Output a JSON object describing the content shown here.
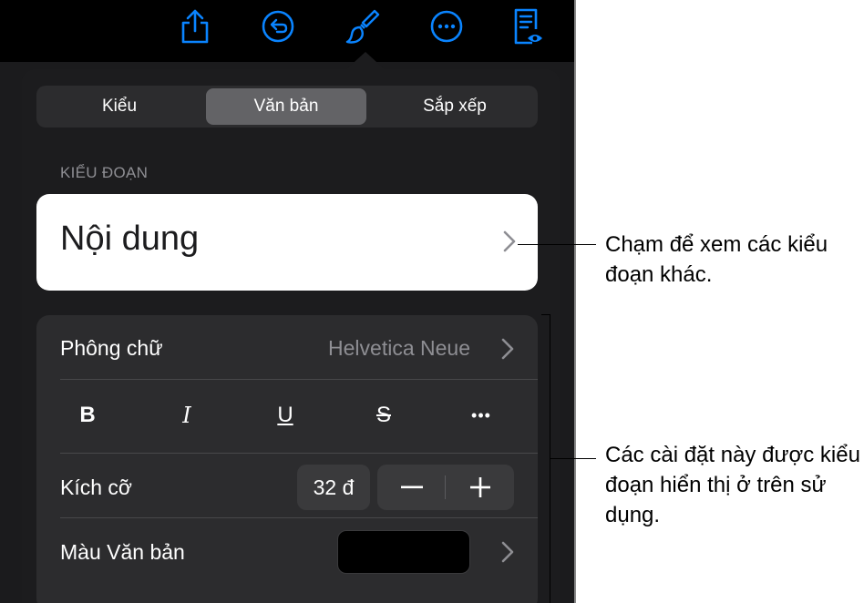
{
  "toolbar": {
    "icons": [
      "share-icon",
      "undo-icon",
      "format-brush-icon",
      "more-icon",
      "reader-view-icon"
    ]
  },
  "tabs": [
    {
      "label": "Kiểu",
      "active": false
    },
    {
      "label": "Văn bản",
      "active": true
    },
    {
      "label": "Sắp xếp",
      "active": false
    }
  ],
  "paragraph_style": {
    "section_label": "KIỂU ĐOẠN",
    "current": "Nội dung"
  },
  "font": {
    "label": "Phông chữ",
    "value": "Helvetica Neue"
  },
  "format_buttons": {
    "bold": "B",
    "italic": "I",
    "underline": "U",
    "strikethrough": "S",
    "more": "•••"
  },
  "size": {
    "label": "Kích cỡ",
    "value": "32 đ",
    "decrement": "−",
    "increment": "+"
  },
  "text_color": {
    "label": "Màu Văn bản",
    "swatch": "#000000"
  },
  "callouts": {
    "top": "Chạm để xem các kiểu đoạn khác.",
    "bottom": "Các cài đặt này được kiểu đoạn hiển thị ở trên sử dụng."
  },
  "colors": {
    "accent": "#0a84ff",
    "popover_bg": "#1c1c1e",
    "group_bg": "#2c2c2e"
  }
}
